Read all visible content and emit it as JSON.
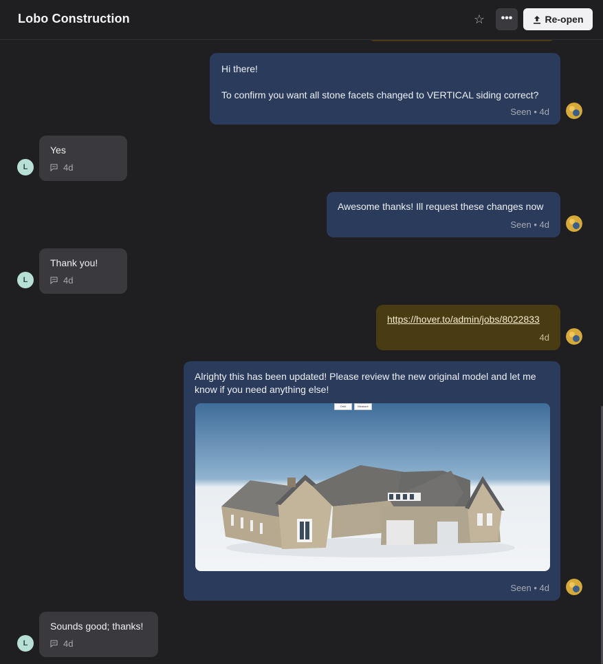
{
  "header": {
    "title": "Lobo Construction",
    "reopen_label": "Re-open",
    "more_label": "•••",
    "star_glyph": "☆"
  },
  "colors": {
    "background": "#1f1f21",
    "outgoing_bubble": "#2b3b5c",
    "incoming_bubble": "#3a3a3e",
    "link_bubble": "#4a3c12",
    "contact_avatar": "#b7dfd6"
  },
  "contact": {
    "initial": "L"
  },
  "messages": [
    {
      "direction": "outgoing",
      "line1": "Hi there!",
      "line2": "To confirm you want all stone facets changed to VERTICAL siding correct?",
      "meta": "Seen • 4d"
    },
    {
      "direction": "incoming",
      "text": "Yes",
      "time": "4d"
    },
    {
      "direction": "outgoing",
      "text": "Awesome thanks! Ill request these changes now",
      "meta": "Seen • 4d"
    },
    {
      "direction": "incoming",
      "text": "Thank you!",
      "time": "4d"
    },
    {
      "direction": "outgoing",
      "link": "https://hover.to/admin/jobs/8022833",
      "meta": "4d"
    },
    {
      "direction": "outgoing",
      "line1": "Alrighty this has been updated! Please review the new original model and let me",
      "line2": "know if you need anything else!",
      "image": {
        "subject": "3D house model render",
        "toolbar_buttons": [
          "Orbit",
          "Measure"
        ]
      },
      "meta": "Seen • 4d"
    },
    {
      "direction": "incoming",
      "text": "Sounds good; thanks!",
      "time": "4d"
    }
  ]
}
